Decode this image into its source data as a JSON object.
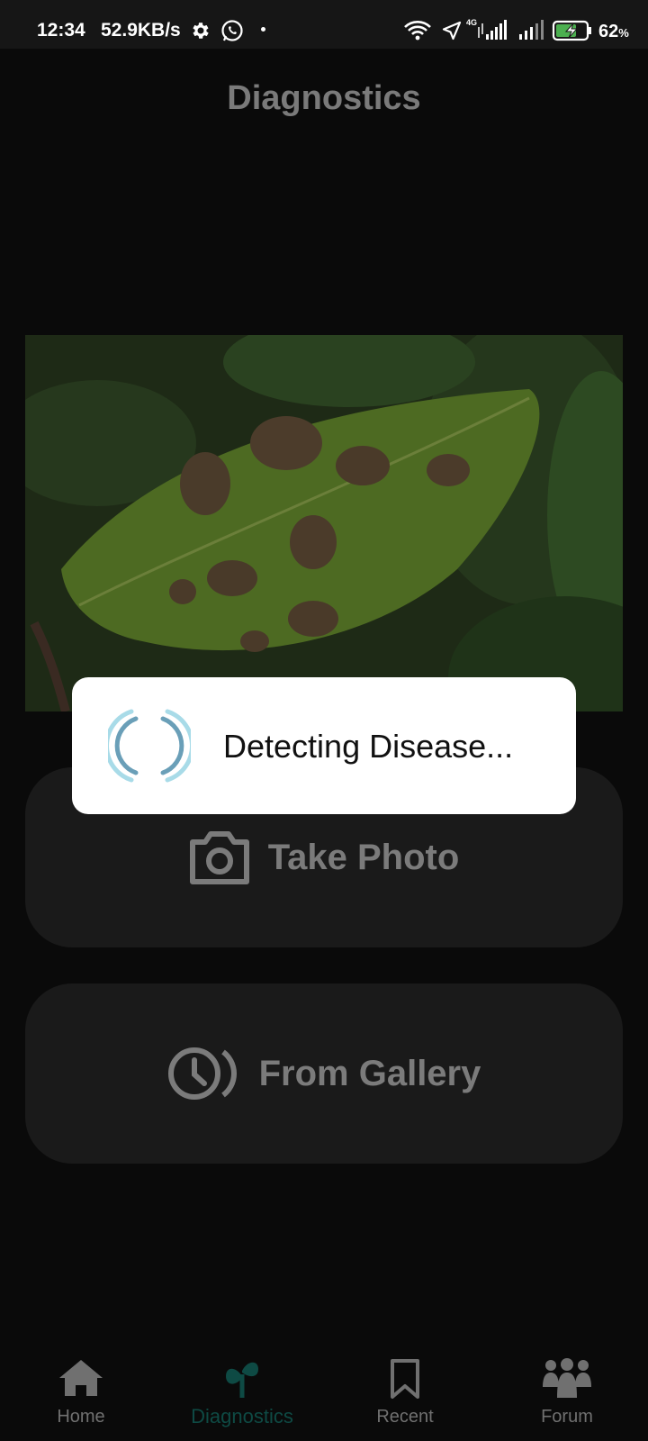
{
  "status_bar": {
    "time": "12:34",
    "speed": "52.9KB/s",
    "network_type": "4G",
    "battery_percent": "62",
    "battery_unit": "%"
  },
  "page": {
    "title": "Diagnostics"
  },
  "image": {
    "icon": "potato-leaf-with-blight-spots-photo"
  },
  "actions": {
    "take_photo_label": "Take Photo",
    "from_gallery_label": "From Gallery"
  },
  "dialog": {
    "message": "Detecting Disease..."
  },
  "bottom_nav": {
    "items": [
      {
        "label": "Home",
        "icon": "home-icon"
      },
      {
        "label": "Diagnostics",
        "icon": "plant-icon",
        "active": true
      },
      {
        "label": "Recent",
        "icon": "bookmark-icon"
      },
      {
        "label": "Forum",
        "icon": "people-icon"
      }
    ]
  },
  "colors": {
    "background": "#0a0a0a",
    "button_bg": "#1a1a1a",
    "active_nav": "#0e4a44",
    "spinner_light": "#a8dbe8",
    "spinner_dark": "#6a9fb8"
  }
}
